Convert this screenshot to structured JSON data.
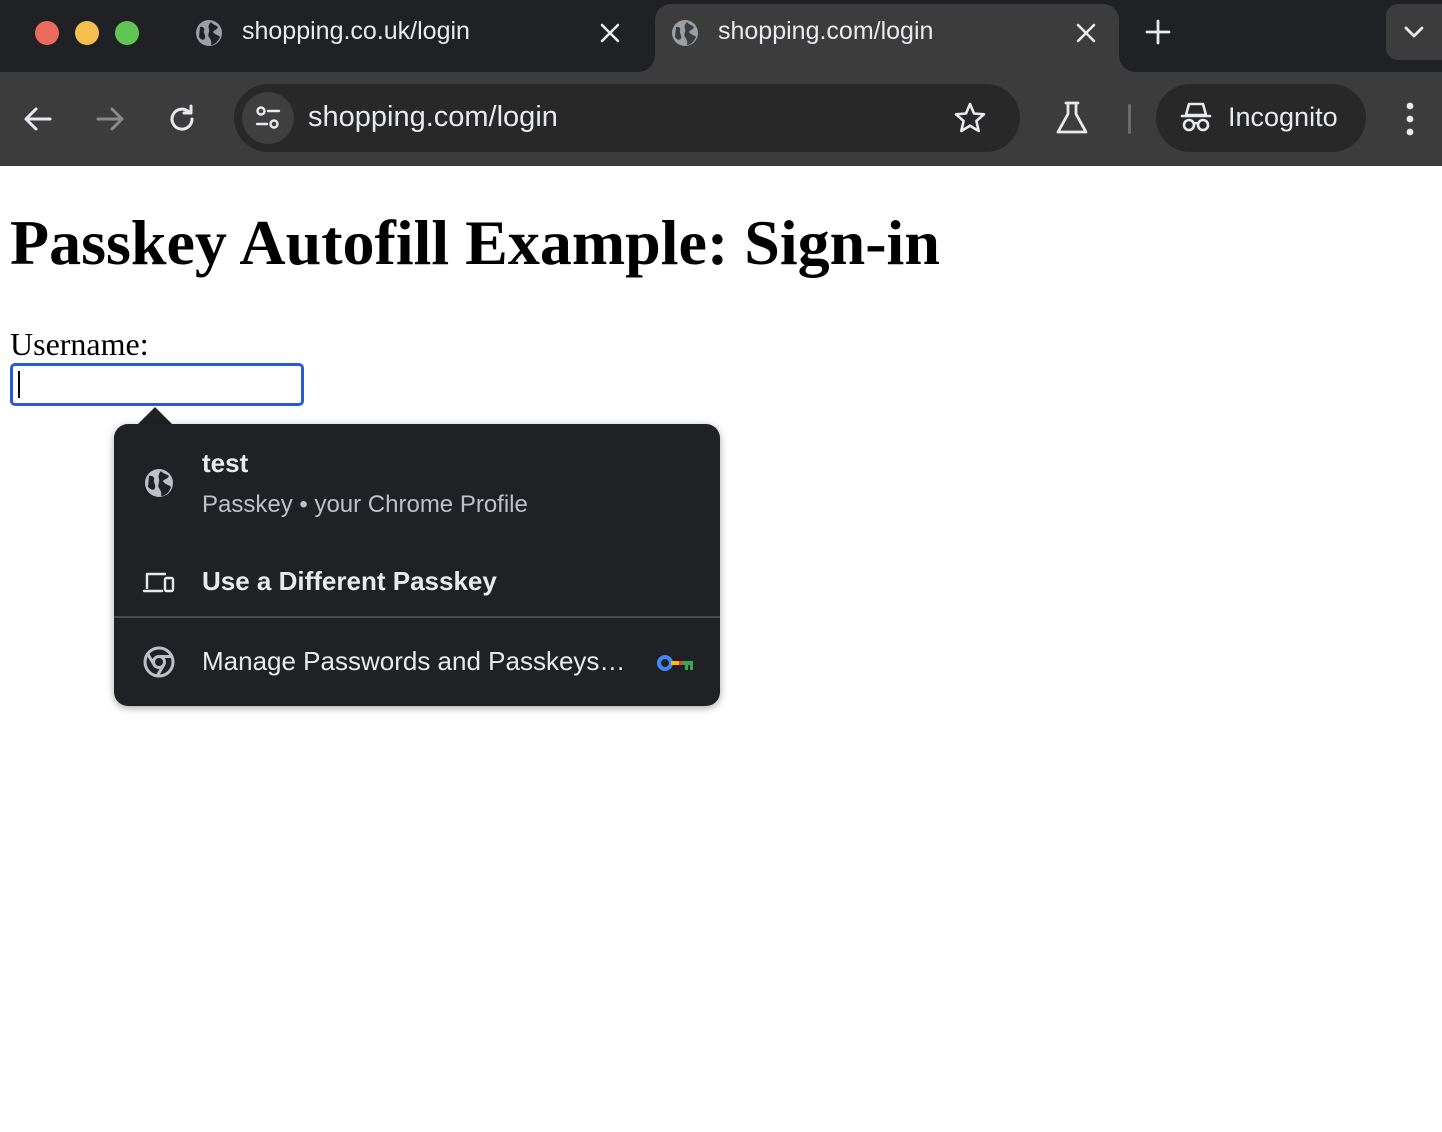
{
  "browser": {
    "window_controls": [
      "close",
      "minimize",
      "maximize"
    ],
    "tabs": [
      {
        "title": "shopping.co.uk/login",
        "active": false,
        "favicon": "globe-icon"
      },
      {
        "title": "shopping.com/login",
        "active": true,
        "favicon": "globe-icon"
      }
    ],
    "omnibox": {
      "url": "shopping.com/login"
    },
    "incognito_label": "Incognito"
  },
  "page": {
    "heading": "Passkey Autofill Example: Sign-in",
    "username_label": "Username:",
    "username_value": ""
  },
  "autofill_popup": {
    "passkey": {
      "name": "test",
      "subtitle": "Passkey • your Chrome Profile",
      "icon": "globe-icon"
    },
    "different_passkey_label": "Use a Different Passkey",
    "manage_label": "Manage Passwords and Passkeys…"
  },
  "colors": {
    "tabstrip_bg": "#202124",
    "toolbar_bg": "#3c3c3c",
    "input_focus": "#2a5bd7",
    "popup_bg": "#202124"
  }
}
